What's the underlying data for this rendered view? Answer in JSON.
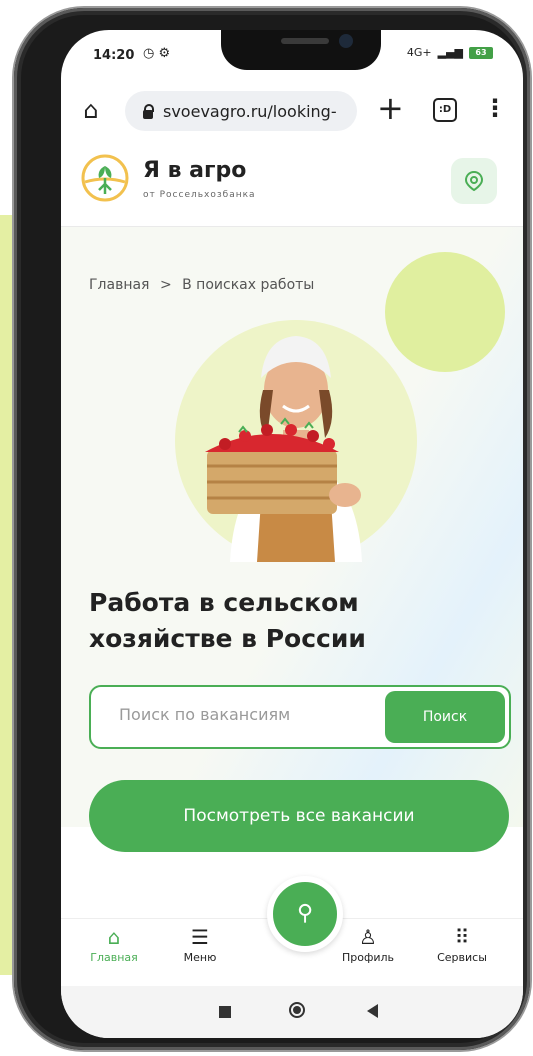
{
  "status_bar": {
    "time": "14:20",
    "icons": "◷ ⚙",
    "network": "4G+",
    "battery": "63"
  },
  "browser": {
    "url": "svoevagro.ru/looking-",
    "tab_count": ":D"
  },
  "header": {
    "brand": "Я в агро",
    "subtitle": "от Россельхозбанка"
  },
  "breadcrumb": {
    "home": "Главная",
    "separator": ">",
    "current": "В поисках работы"
  },
  "hero": {
    "title": "Работа в сельском хозяйстве в России"
  },
  "search": {
    "placeholder": "Поиск по вакансиям",
    "button": "Поиск"
  },
  "cta": {
    "label": "Посмотреть все вакансии"
  },
  "bottom_nav": {
    "items": [
      {
        "label": "Главная",
        "icon": "home-icon"
      },
      {
        "label": "Меню",
        "icon": "menu-icon"
      },
      {
        "label": "Профиль",
        "icon": "profile-icon"
      },
      {
        "label": "Сервисы",
        "icon": "grid-icon"
      }
    ]
  },
  "colors": {
    "accent": "#4aae55",
    "deco": "#e0ef9f",
    "side_blob": "#e4efa3"
  }
}
